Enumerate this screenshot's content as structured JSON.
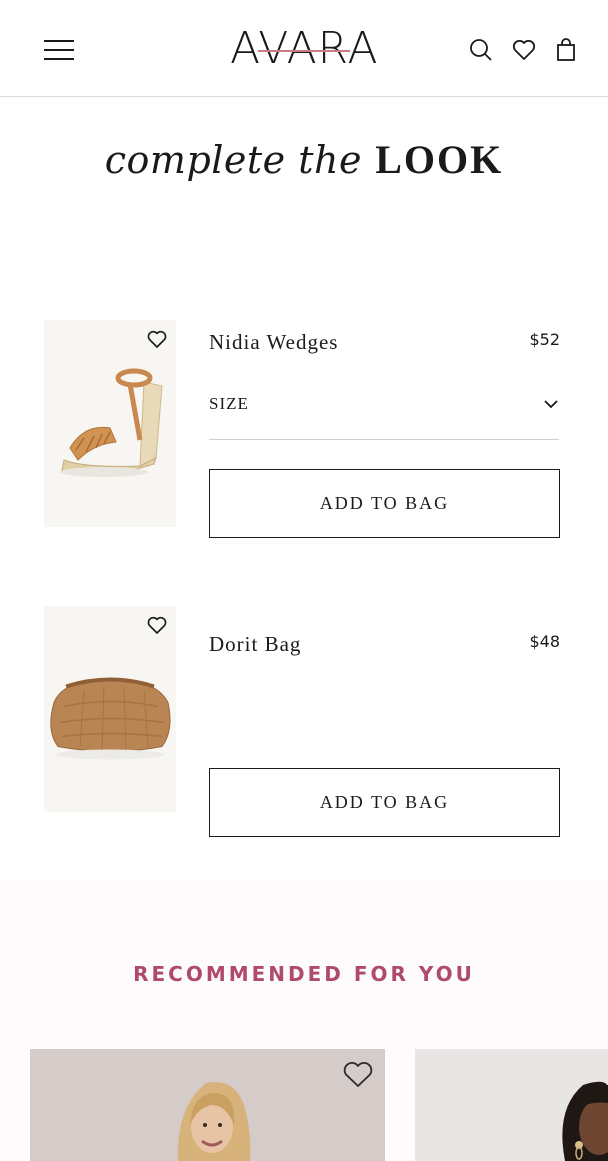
{
  "header": {
    "brand": "AVARA",
    "icons": [
      "menu-icon",
      "search-icon",
      "heart-icon",
      "bag-icon"
    ]
  },
  "title": {
    "italic": "complete the",
    "caps": "LOOK"
  },
  "products": [
    {
      "name": "Nidia Wedges",
      "price": "$52",
      "size_label": "SIZE",
      "add_label": "ADD TO BAG"
    },
    {
      "name": "Dorit Bag",
      "price": "$48",
      "add_label": "ADD TO BAG"
    }
  ],
  "recommended": {
    "title": "RECOMMENDED FOR YOU"
  },
  "colors": {
    "accent": "#b04a6d",
    "logo_bar": "#c97c86",
    "text": "#1a1a1a"
  }
}
